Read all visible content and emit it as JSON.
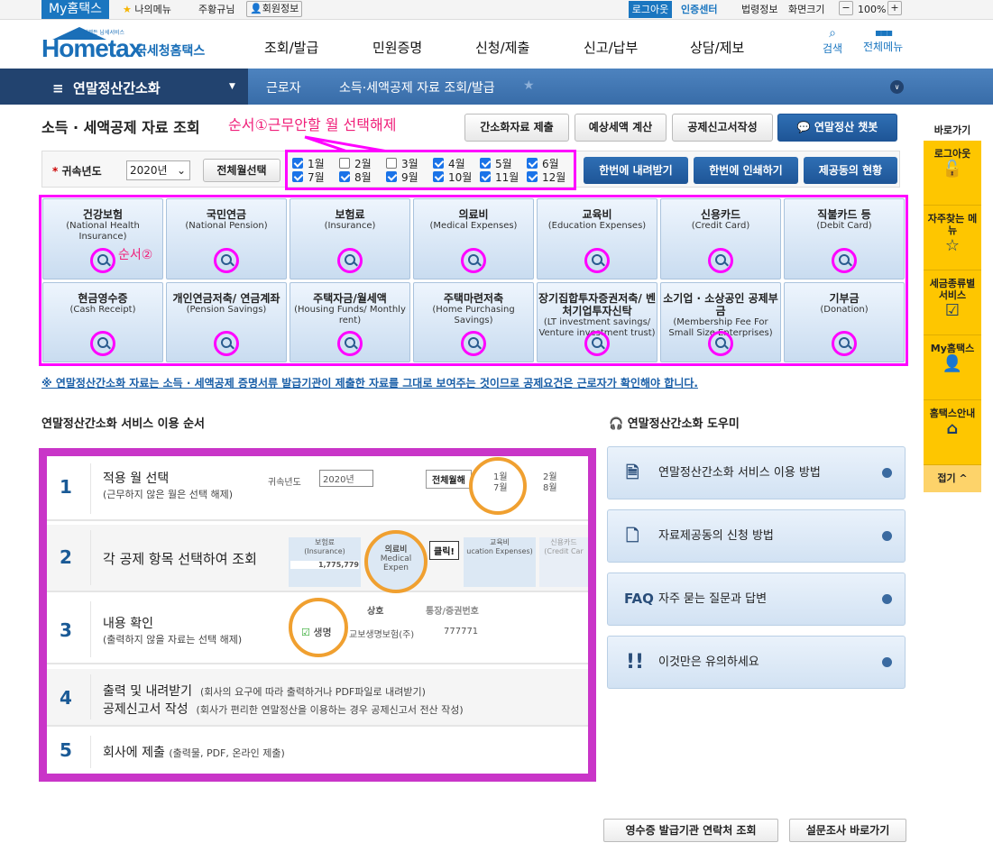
{
  "topbar": {
    "my_hometax": "My홈택스",
    "my_menu": "나의메뉴",
    "user": "주황규님",
    "member_info": "회원정보",
    "logout": "로그아웃",
    "cert_center": "인증센터",
    "law_info": "법령정보",
    "screen_size": "화면크기",
    "zoom": "100%"
  },
  "header": {
    "logo_text": "Hometax",
    "logo_sub": "국세청홈택스",
    "logo_tag": "언제든 납세서비스",
    "menu": [
      "조회/발급",
      "민원증명",
      "신청/제출",
      "신고/납부",
      "상담/제보"
    ],
    "search": "검색",
    "all_menu": "전체메뉴"
  },
  "nav": {
    "section": "연말정산간소화",
    "crumb1": "근로자",
    "crumb2": "소득·세액공제 자료 조회/발급"
  },
  "page": {
    "title": "소득 · 세액공제 자료 조회",
    "annotation1": "순서①근무안할 월 선택해제",
    "annotation2": "순서②",
    "buttons": [
      "간소화자료 제출",
      "예상세액 계산",
      "공제신고서작성",
      "연말정산 챗봇"
    ],
    "year_label": "귀속년도",
    "year_value": "2020년",
    "select_all": "전체월선택",
    "months": [
      {
        "label": "1월",
        "checked": true
      },
      {
        "label": "2월",
        "checked": false
      },
      {
        "label": "3월",
        "checked": false
      },
      {
        "label": "4월",
        "checked": true
      },
      {
        "label": "5월",
        "checked": true
      },
      {
        "label": "6월",
        "checked": true
      },
      {
        "label": "7월",
        "checked": true
      },
      {
        "label": "8월",
        "checked": true
      },
      {
        "label": "9월",
        "checked": true
      },
      {
        "label": "10월",
        "checked": true
      },
      {
        "label": "11월",
        "checked": true
      },
      {
        "label": "12월",
        "checked": true
      }
    ],
    "action_buttons": [
      "한번에 내려받기",
      "한번에 인쇄하기",
      "제공동의 현황"
    ]
  },
  "categories": [
    {
      "ko": "건강보험",
      "en": "(National Health Insurance)"
    },
    {
      "ko": "국민연금",
      "en": "(National Pension)"
    },
    {
      "ko": "보험료",
      "en": "(Insurance)"
    },
    {
      "ko": "의료비",
      "en": "(Medical Expenses)"
    },
    {
      "ko": "교육비",
      "en": "(Education Expenses)"
    },
    {
      "ko": "신용카드",
      "en": "(Credit Card)"
    },
    {
      "ko": "직불카드 등",
      "en": "(Debit Card)"
    },
    {
      "ko": "현금영수증",
      "en": "(Cash Receipt)"
    },
    {
      "ko": "개인연금저축/ 연금계좌",
      "en": "(Pension Savings)"
    },
    {
      "ko": "주택자금/월세액",
      "en": "(Housing Funds/ Monthly rent)"
    },
    {
      "ko": "주택마련저축",
      "en": "(Home Purchasing Savings)"
    },
    {
      "ko": "장기집합투자증권저축/ 벤처기업투자신탁",
      "en": "(LT investment savings/ Venture investment trust)"
    },
    {
      "ko": "소기업 · 소상공인 공제부금",
      "en": "(Membership Fee For Small Size Enterprises)"
    },
    {
      "ko": "기부금",
      "en": "(Donation)"
    }
  ],
  "notice": "※ 연말정산간소화 자료는 소득 · 세액공제 증명서류 발급기관이 제출한 자료를 그대로 보여주는 것이므로 공제요건은 근로자가 확인해야 합니다.",
  "steps_title": "연말정산간소화 서비스 이용 순서",
  "steps": [
    {
      "num": "1",
      "title": "적용 월 선택",
      "sub": "(근무하지 않은 월은 선택 해제)"
    },
    {
      "num": "2",
      "title": "각 공제 항목 선택하여 조회",
      "sub": ""
    },
    {
      "num": "3",
      "title": "내용 확인",
      "sub": "(출력하지 않을 자료는 선택 해제)"
    },
    {
      "num": "4",
      "title": "출력 및 내려받기",
      "sub": "(회사의 요구에 따라 출력하거나 PDF파일로 내려받기)",
      "title2": "공제신고서 작성",
      "sub2": "(회사가 편리한 연말정산을 이용하는 경우 공제신고서 전산 작성)"
    },
    {
      "num": "5",
      "title": "회사에 제출",
      "sub": "(출력물, PDF, 온라인 제출)"
    }
  ],
  "step_illus": {
    "year_label": "귀속년도",
    "year": "2020년",
    "select_all": "전체월해",
    "m1": "1월",
    "m2": "2월",
    "m7": "7월",
    "m8": "8월",
    "ins": "보험료",
    "ins_en": "(Insurance)",
    "ins_val": "1,775,779",
    "med": "의료비",
    "med_en": "Medical Expen",
    "click": "클릭!",
    "edu": "교육비",
    "edu_en": "ucation Expenses)",
    "card": "신용카드",
    "card_en": "(Credit Car",
    "col1": "상호",
    "col2": "통장/증권번호",
    "row1": "교보생명보험(주)",
    "row1_no": "777771",
    "life": "생명"
  },
  "helper": {
    "title": "연말정산간소화 도우미",
    "items": [
      {
        "icon": "document-icon",
        "label": "연말정산간소화 서비스 이용 방법"
      },
      {
        "icon": "form-icon",
        "label": "자료제공동의 신청 방법"
      },
      {
        "icon": "faq-icon",
        "label": "자주 묻는 질문과 답변",
        "prefix": "FAQ"
      },
      {
        "icon": "exclamation-icon",
        "label": "이것만은 유의하세요"
      }
    ]
  },
  "bottom": {
    "contact": "영수증 발급기관 연락처 조회",
    "survey": "설문조사 바로가기"
  },
  "quick": {
    "title": "바로가기",
    "items": [
      "로그아웃",
      "자주찾는 메뉴",
      "세금종류별 서비스",
      "My홈택스",
      "홈택스안내"
    ],
    "collapse": "접기 ^"
  },
  "colors": {
    "brand": "#1a76c0",
    "nav_dark": "#22436f",
    "highlight": "#ff00ff",
    "steps_border": "#c935c8",
    "quick": "#fec600"
  }
}
